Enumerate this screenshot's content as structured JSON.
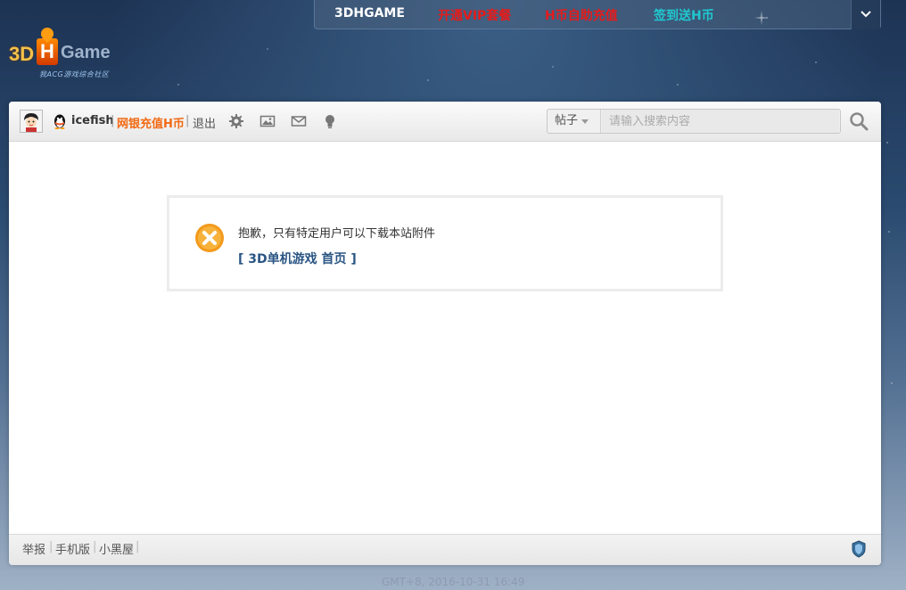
{
  "topnav": {
    "brand": "3DHGAME",
    "vip": "开通VIP套餐",
    "recharge": "H币自助充值",
    "checkin": "签到送H币"
  },
  "logo": {
    "digit": "3D",
    "letter": "H",
    "word": "Game",
    "tagline": "我ACG游戏综合社区"
  },
  "toolbar": {
    "username": "icefish",
    "separator": "|",
    "recharge_link": "网银充值H币",
    "logout": "退出",
    "icons": [
      "gear-icon",
      "image-icon",
      "mail-icon",
      "bulb-icon"
    ]
  },
  "search": {
    "type": "帖子",
    "placeholder": "请输入搜索内容"
  },
  "message": {
    "text": "抱歉，只有特定用户可以下载本站附件",
    "link": "[ 3D单机游戏 首页 ]"
  },
  "footer": {
    "links": [
      "举报",
      "手机版",
      "小黑屋"
    ],
    "separator": "|"
  },
  "timestamp": "GMT+8, 2016-10-31 16:49",
  "colors": {
    "vip_red": "#e41b1b",
    "checkin_cyan": "#20c8cf",
    "recharge_orange": "#f26a13",
    "link_blue": "#2a5583",
    "error_orange": "#f39a1c"
  }
}
